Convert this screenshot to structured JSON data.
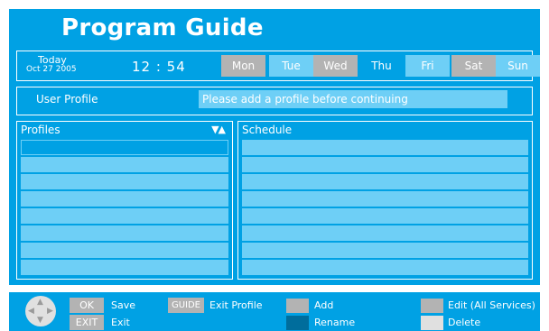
{
  "title": "Program Guide",
  "today": {
    "label": "Today",
    "date": "Oct 27 2005"
  },
  "clock": "12 : 54",
  "days": [
    "Mon",
    "Tue",
    "Wed",
    "Thu",
    "Fri",
    "Sat",
    "Sun"
  ],
  "selected_day": "Thu",
  "user_profile": {
    "label": "User Profile",
    "message": "Please add a profile before continuing"
  },
  "profiles": {
    "header": "Profiles",
    "sort_icon": "▼▲"
  },
  "schedule": {
    "header": "Schedule"
  },
  "footer": {
    "ok_key": "OK",
    "ok_label": "Save",
    "exit_key": "EXIT",
    "exit_label": "Exit",
    "guide_key": "GUIDE",
    "guide_label": "Exit Profile",
    "add_label": "Add",
    "rename_label": "Rename",
    "edit_label": "Edit (All Services)",
    "delete_label": "Delete"
  },
  "colors": {
    "panel": "#00a1e4",
    "row": "#6ecff6",
    "gray_key": "#b3b3b3",
    "rename_swatch": "#006d9c",
    "delete_swatch": "#e0e0e0"
  }
}
